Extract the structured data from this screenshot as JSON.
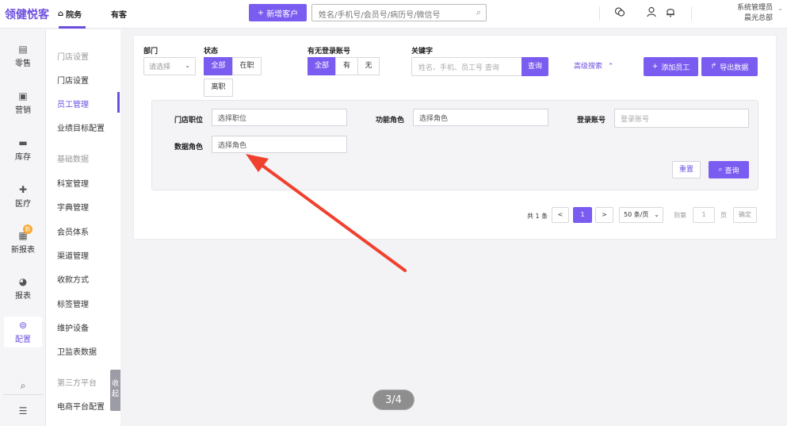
{
  "app": {
    "logo": "领健悦客"
  },
  "topnav": {
    "home_label": "院务",
    "guest_label": "有客",
    "new_customer_label": "新增客户",
    "search_placeholder": "姓名/手机号/会员号/病历号/微信号",
    "user_role": "系统管理员",
    "user_store": "晨光总部"
  },
  "leftnav": {
    "items": [
      {
        "label": "零售",
        "icon": "retail-icon"
      },
      {
        "label": "营销",
        "icon": "marketing-icon"
      },
      {
        "label": "库存",
        "icon": "inventory-icon"
      },
      {
        "label": "医疗",
        "icon": "medical-icon"
      },
      {
        "label": "新报表",
        "icon": "new-report-icon",
        "badge": "新"
      },
      {
        "label": "报表",
        "icon": "report-icon"
      },
      {
        "label": "配置",
        "icon": "config-icon",
        "active": true
      }
    ]
  },
  "subnav": {
    "items": [
      {
        "label": "门店设置",
        "type": "header"
      },
      {
        "label": "门店设置"
      },
      {
        "label": "员工管理",
        "active": true
      },
      {
        "label": "业绩目标配置"
      },
      {
        "label": "基础数据",
        "type": "header"
      },
      {
        "label": "科室管理"
      },
      {
        "label": "字典管理"
      },
      {
        "label": "会员体系"
      },
      {
        "label": "渠道管理"
      },
      {
        "label": "收款方式"
      },
      {
        "label": "标签管理"
      },
      {
        "label": "维护设备"
      },
      {
        "label": "卫监表数据"
      },
      {
        "label": "第三方平台",
        "type": "header"
      },
      {
        "label": "电商平台配置"
      }
    ],
    "collapse_label": "收起"
  },
  "filters": {
    "department_label": "部门",
    "department_placeholder": "请选择",
    "status_label": "状态",
    "status_options": [
      "全部",
      "在职",
      "离职"
    ],
    "status_selected": "全部",
    "login_label": "有无登录账号",
    "login_options": [
      "全部",
      "有",
      "无"
    ],
    "login_selected": "全部",
    "keyword_label": "关键字",
    "keyword_placeholder": "姓名、手机、员工号 查询",
    "query_label": "查询",
    "advanced_label": "高级搜索",
    "add_employee_label": "添加员工",
    "export_label": "导出数据"
  },
  "advanced": {
    "position_label": "门店职位",
    "position_value": "选择职位",
    "function_role_label": "功能角色",
    "function_role_value": "选择角色",
    "login_account_label": "登录账号",
    "login_account_placeholder": "登录账号",
    "data_role_label": "数据角色",
    "data_role_value": "选择角色",
    "reset_label": "重置",
    "query_label": "查询"
  },
  "pager": {
    "total": "共 1 条",
    "prev": "<",
    "current": "1",
    "next": ">",
    "page_size": "50 条/页",
    "goto_label": "到第",
    "goto_value": "1",
    "page_unit": "页",
    "confirm_label": "确定"
  },
  "page_indicator": "3/4",
  "colors": {
    "accent": "#7b5cf0",
    "annotation_arrow": "#f0412e"
  }
}
